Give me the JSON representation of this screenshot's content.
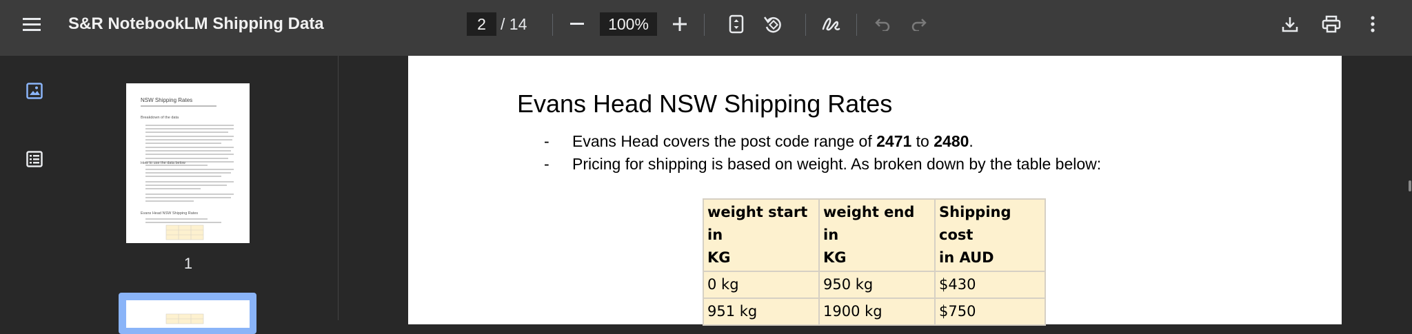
{
  "toolbar": {
    "title": "S&R NotebookLM Shipping Data",
    "current_page": "2",
    "total_pages": "/ 14",
    "zoom": "100%"
  },
  "sidebar": {
    "thumbnail_1_label": "1"
  },
  "document": {
    "title": "Evans Head NSW Shipping Rates",
    "bullet_marker": "-",
    "bullet1_pre": "Evans Head covers the post code range of ",
    "bullet1_from": "2471",
    "bullet1_mid": " to ",
    "bullet1_to": "2480",
    "bullet1_post": ".",
    "bullet2": "Pricing for shipping is based on weight. As broken down by the table below:",
    "table": {
      "headers": [
        "weight start in KG",
        "weight end in KG",
        "Shipping cost in AUD"
      ],
      "header_lines": [
        [
          "weight start in",
          "KG"
        ],
        [
          "weight end in",
          "KG"
        ],
        [
          "Shipping cost",
          "in AUD"
        ]
      ],
      "rows": [
        [
          "0 kg",
          "950 kg",
          "$430"
        ],
        [
          "951 kg",
          "1900 kg",
          "$750"
        ]
      ]
    }
  },
  "thumbnail_text": {
    "title": "NSW Shipping Rates",
    "section1": "Breakdown of the data",
    "section2": "How to use the data below",
    "section3": "Evans Head NSW Shipping Rates"
  },
  "colors": {
    "toolbar_bg": "#3c3c3c",
    "viewer_bg": "#282828",
    "table_cell_bg": "#fdf1cf",
    "thumbnail_selected": "#8ab4f8"
  }
}
